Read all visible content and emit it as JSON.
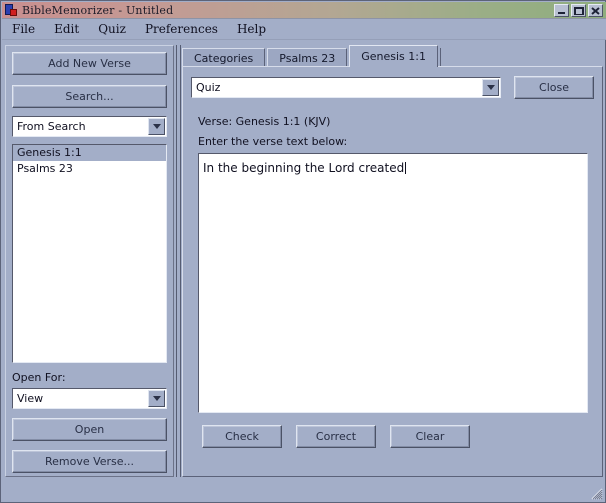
{
  "window": {
    "title": "BibleMemorizer - Untitled",
    "icon": "app-book-icon",
    "controls": {
      "minimize": "minimize-icon",
      "maximize": "maximize-icon",
      "close": "close-icon"
    }
  },
  "menubar": {
    "items": [
      {
        "label": "File"
      },
      {
        "label": "Edit"
      },
      {
        "label": "Quiz"
      },
      {
        "label": "Preferences"
      },
      {
        "label": "Help"
      }
    ]
  },
  "sidebar": {
    "add_new_verse_label": "Add New Verse",
    "search_label": "Search...",
    "source_combo": {
      "value": "From Search",
      "arrow": "chevron-down-icon"
    },
    "verse_list": [
      {
        "label": "Genesis 1:1",
        "selected": true
      },
      {
        "label": "Psalms 23",
        "selected": false
      }
    ],
    "open_for_label": "Open For:",
    "open_for_combo": {
      "value": "View",
      "arrow": "chevron-down-icon"
    },
    "open_label": "Open",
    "remove_verse_label": "Remove Verse..."
  },
  "main": {
    "tabs": [
      {
        "label": "Categories",
        "active": false
      },
      {
        "label": "Psalms 23",
        "active": false
      },
      {
        "label": "Genesis 1:1",
        "active": true
      }
    ],
    "mode_combo": {
      "value": "Quiz",
      "arrow": "chevron-down-icon"
    },
    "close_label": "Close",
    "verse_label": "Verse:  Genesis 1:1 (KJV)",
    "enter_label": "Enter the verse text below:",
    "verse_text": "In the beginning the Lord created",
    "buttons": {
      "check_label": "Check",
      "correct_label": "Correct",
      "clear_label": "Clear"
    }
  },
  "colors": {
    "window_background": "#a3aec8",
    "titlebar_left": "#c98f8f",
    "titlebar_right": "#8fae7e",
    "field_background": "#ffffff",
    "text": "#101020"
  }
}
